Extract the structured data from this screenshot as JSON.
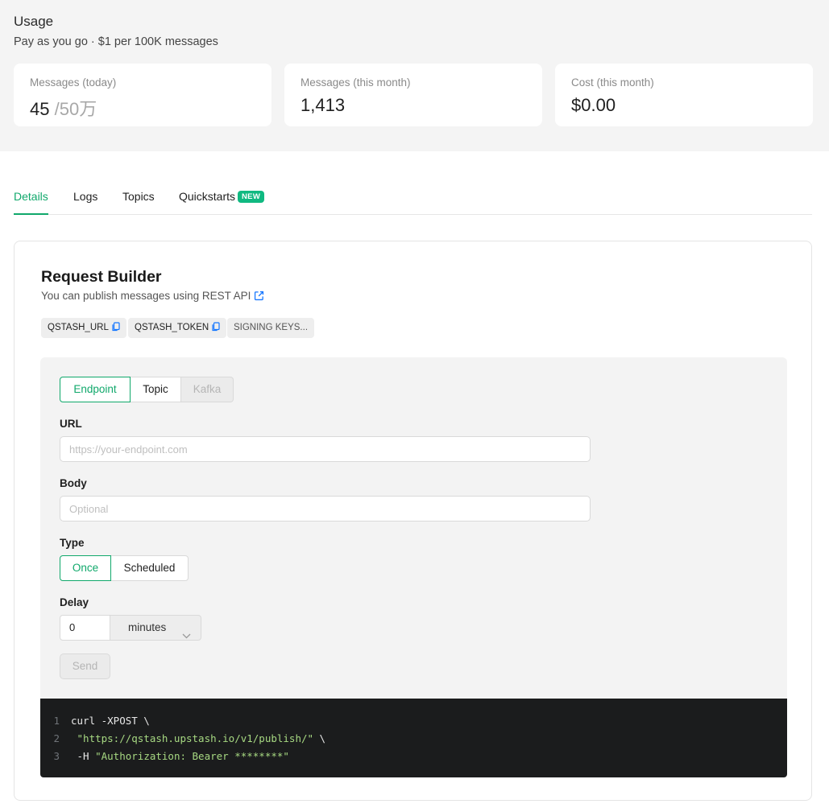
{
  "usage": {
    "title": "Usage",
    "subtitle": "Pay as you go · $1 per 100K messages",
    "stats": [
      {
        "label": "Messages (today)",
        "value": "45",
        "limit": "/50万"
      },
      {
        "label": "Messages (this month)",
        "value": "1,413"
      },
      {
        "label": "Cost (this month)",
        "value": "$0.00"
      }
    ]
  },
  "tabs": {
    "items": [
      {
        "label": "Details"
      },
      {
        "label": "Logs"
      },
      {
        "label": "Topics"
      },
      {
        "label": "Quickstarts",
        "badge": "NEW"
      }
    ],
    "active": "Details"
  },
  "request_builder": {
    "title": "Request Builder",
    "subtitle": "You can publish messages using REST API",
    "chips": [
      "QSTASH_URL",
      "QSTASH_TOKEN",
      "SIGNING KEYS..."
    ],
    "target_tabs": [
      "Endpoint",
      "Topic",
      "Kafka"
    ],
    "url_label": "URL",
    "url_placeholder": "https://your-endpoint.com",
    "body_label": "Body",
    "body_placeholder": "Optional",
    "type_label": "Type",
    "type_options": [
      "Once",
      "Scheduled"
    ],
    "delay_label": "Delay",
    "delay_value": "0",
    "delay_unit": "minutes",
    "send_label": "Send"
  },
  "code": {
    "lines": [
      {
        "num": "1",
        "parts": [
          {
            "t": "curl -XPOST \\",
            "k": "plain"
          }
        ]
      },
      {
        "num": "2",
        "parts": [
          {
            "t": " \"https://qstash.upstash.io/v1/publish/\"",
            "k": "str"
          },
          {
            "t": " \\",
            "k": "plain"
          }
        ]
      },
      {
        "num": "3",
        "parts": [
          {
            "t": " -H ",
            "k": "plain"
          },
          {
            "t": "\"Authorization: Bearer ********\"",
            "k": "str"
          }
        ]
      }
    ]
  },
  "colors": {
    "accent": "#10a86b",
    "badge": "#10b981",
    "link_icon": "#1677ff"
  }
}
